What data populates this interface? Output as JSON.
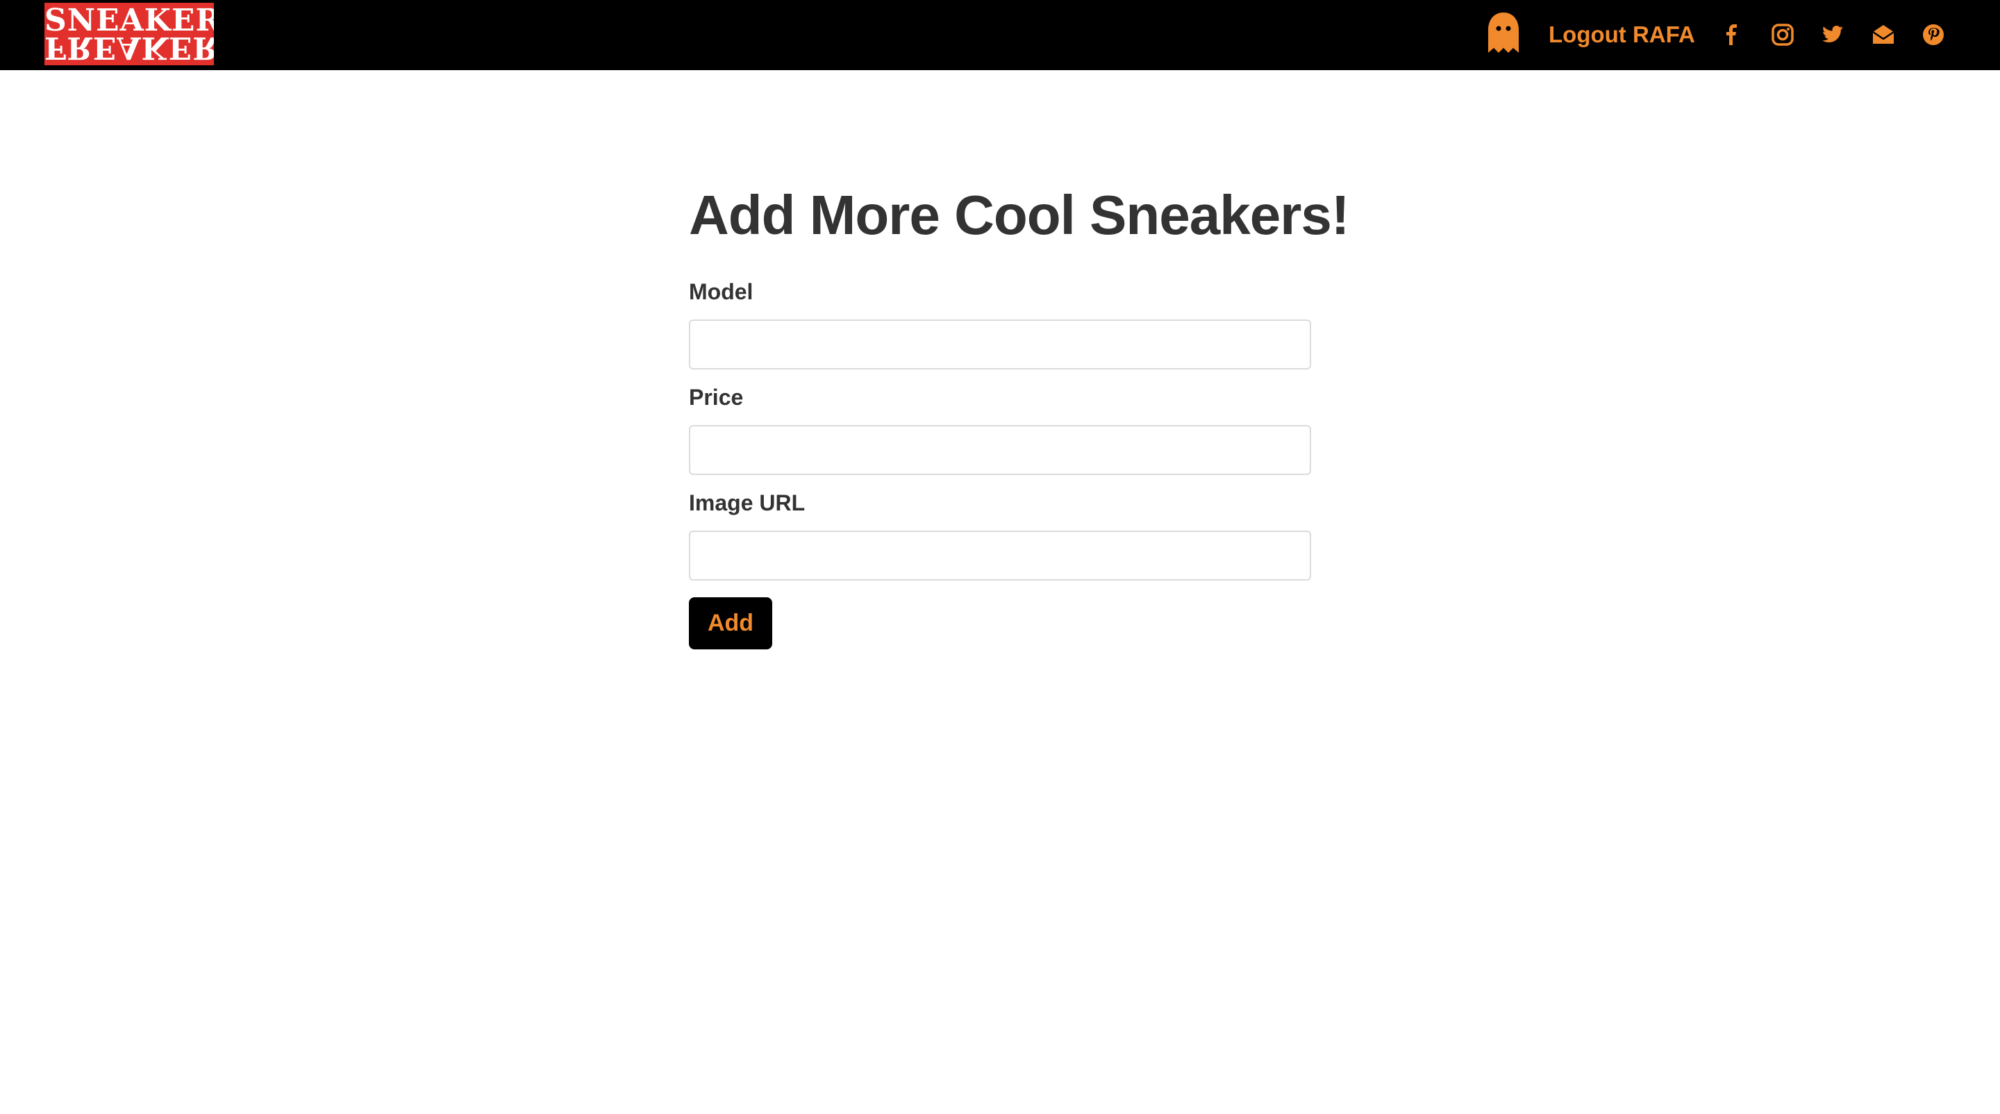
{
  "header": {
    "logo_top": "SNEAKER",
    "logo_bottom": "FREAKER",
    "logout_label": "Logout RAFA",
    "social_icons": [
      "facebook-icon",
      "instagram-icon",
      "twitter-icon",
      "envelope-icon",
      "pinterest-icon"
    ]
  },
  "form": {
    "title": "Add More Cool Sneakers!",
    "fields": [
      {
        "label": "Model",
        "value": "",
        "placeholder": ""
      },
      {
        "label": "Price",
        "value": "",
        "placeholder": ""
      },
      {
        "label": "Image URL",
        "value": "",
        "placeholder": ""
      }
    ],
    "submit_label": "Add"
  },
  "colors": {
    "accent": "#f08a2c",
    "navbar": "#000000",
    "logo_bg": "#e2302c",
    "text": "#333333"
  }
}
